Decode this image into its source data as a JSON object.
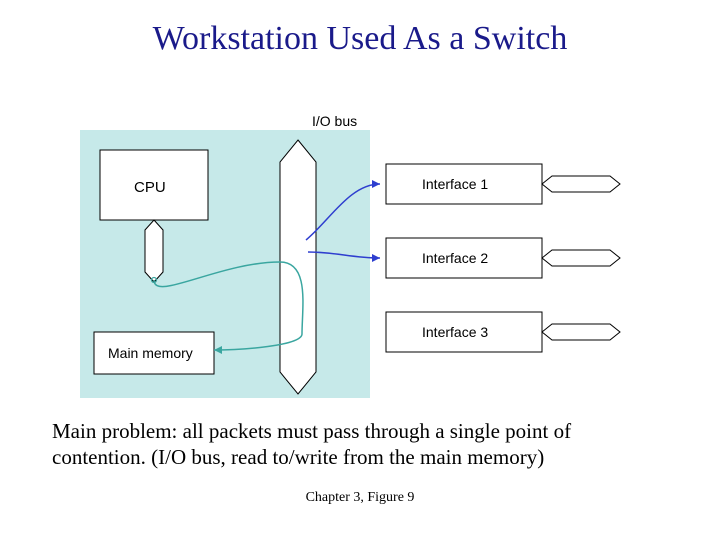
{
  "title": "Workstation Used As a Switch",
  "caption": "Main problem: all packets must pass through a single point of contention. (I/O bus, read to/write from the main memory)",
  "figref": "Chapter 3, Figure 9",
  "diagram": {
    "io_bus": "I/O bus",
    "cpu": "CPU",
    "main_memory": "Main memory",
    "interface1": "Interface 1",
    "interface2": "Interface 2",
    "interface3": "Interface 3"
  }
}
